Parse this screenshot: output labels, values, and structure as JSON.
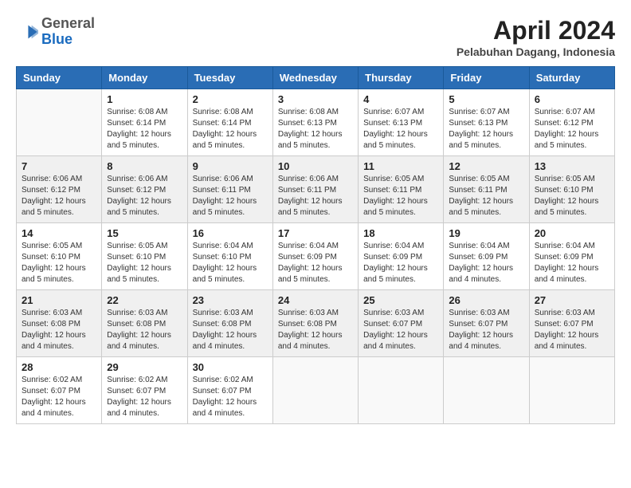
{
  "logo": {
    "general": "General",
    "blue": "Blue"
  },
  "header": {
    "month": "April 2024",
    "location": "Pelabuhan Dagang, Indonesia"
  },
  "weekdays": [
    "Sunday",
    "Monday",
    "Tuesday",
    "Wednesday",
    "Thursday",
    "Friday",
    "Saturday"
  ],
  "weeks": [
    [
      {
        "day": "",
        "info": ""
      },
      {
        "day": "1",
        "info": "Sunrise: 6:08 AM\nSunset: 6:14 PM\nDaylight: 12 hours and 5 minutes."
      },
      {
        "day": "2",
        "info": "Sunrise: 6:08 AM\nSunset: 6:14 PM\nDaylight: 12 hours and 5 minutes."
      },
      {
        "day": "3",
        "info": "Sunrise: 6:08 AM\nSunset: 6:13 PM\nDaylight: 12 hours and 5 minutes."
      },
      {
        "day": "4",
        "info": "Sunrise: 6:07 AM\nSunset: 6:13 PM\nDaylight: 12 hours and 5 minutes."
      },
      {
        "day": "5",
        "info": "Sunrise: 6:07 AM\nSunset: 6:13 PM\nDaylight: 12 hours and 5 minutes."
      },
      {
        "day": "6",
        "info": "Sunrise: 6:07 AM\nSunset: 6:12 PM\nDaylight: 12 hours and 5 minutes."
      }
    ],
    [
      {
        "day": "7",
        "info": "Sunrise: 6:06 AM\nSunset: 6:12 PM\nDaylight: 12 hours and 5 minutes."
      },
      {
        "day": "8",
        "info": "Sunrise: 6:06 AM\nSunset: 6:12 PM\nDaylight: 12 hours and 5 minutes."
      },
      {
        "day": "9",
        "info": "Sunrise: 6:06 AM\nSunset: 6:11 PM\nDaylight: 12 hours and 5 minutes."
      },
      {
        "day": "10",
        "info": "Sunrise: 6:06 AM\nSunset: 6:11 PM\nDaylight: 12 hours and 5 minutes."
      },
      {
        "day": "11",
        "info": "Sunrise: 6:05 AM\nSunset: 6:11 PM\nDaylight: 12 hours and 5 minutes."
      },
      {
        "day": "12",
        "info": "Sunrise: 6:05 AM\nSunset: 6:11 PM\nDaylight: 12 hours and 5 minutes."
      },
      {
        "day": "13",
        "info": "Sunrise: 6:05 AM\nSunset: 6:10 PM\nDaylight: 12 hours and 5 minutes."
      }
    ],
    [
      {
        "day": "14",
        "info": "Sunrise: 6:05 AM\nSunset: 6:10 PM\nDaylight: 12 hours and 5 minutes."
      },
      {
        "day": "15",
        "info": "Sunrise: 6:05 AM\nSunset: 6:10 PM\nDaylight: 12 hours and 5 minutes."
      },
      {
        "day": "16",
        "info": "Sunrise: 6:04 AM\nSunset: 6:10 PM\nDaylight: 12 hours and 5 minutes."
      },
      {
        "day": "17",
        "info": "Sunrise: 6:04 AM\nSunset: 6:09 PM\nDaylight: 12 hours and 5 minutes."
      },
      {
        "day": "18",
        "info": "Sunrise: 6:04 AM\nSunset: 6:09 PM\nDaylight: 12 hours and 5 minutes."
      },
      {
        "day": "19",
        "info": "Sunrise: 6:04 AM\nSunset: 6:09 PM\nDaylight: 12 hours and 4 minutes."
      },
      {
        "day": "20",
        "info": "Sunrise: 6:04 AM\nSunset: 6:09 PM\nDaylight: 12 hours and 4 minutes."
      }
    ],
    [
      {
        "day": "21",
        "info": "Sunrise: 6:03 AM\nSunset: 6:08 PM\nDaylight: 12 hours and 4 minutes."
      },
      {
        "day": "22",
        "info": "Sunrise: 6:03 AM\nSunset: 6:08 PM\nDaylight: 12 hours and 4 minutes."
      },
      {
        "day": "23",
        "info": "Sunrise: 6:03 AM\nSunset: 6:08 PM\nDaylight: 12 hours and 4 minutes."
      },
      {
        "day": "24",
        "info": "Sunrise: 6:03 AM\nSunset: 6:08 PM\nDaylight: 12 hours and 4 minutes."
      },
      {
        "day": "25",
        "info": "Sunrise: 6:03 AM\nSunset: 6:07 PM\nDaylight: 12 hours and 4 minutes."
      },
      {
        "day": "26",
        "info": "Sunrise: 6:03 AM\nSunset: 6:07 PM\nDaylight: 12 hours and 4 minutes."
      },
      {
        "day": "27",
        "info": "Sunrise: 6:03 AM\nSunset: 6:07 PM\nDaylight: 12 hours and 4 minutes."
      }
    ],
    [
      {
        "day": "28",
        "info": "Sunrise: 6:02 AM\nSunset: 6:07 PM\nDaylight: 12 hours and 4 minutes."
      },
      {
        "day": "29",
        "info": "Sunrise: 6:02 AM\nSunset: 6:07 PM\nDaylight: 12 hours and 4 minutes."
      },
      {
        "day": "30",
        "info": "Sunrise: 6:02 AM\nSunset: 6:07 PM\nDaylight: 12 hours and 4 minutes."
      },
      {
        "day": "",
        "info": ""
      },
      {
        "day": "",
        "info": ""
      },
      {
        "day": "",
        "info": ""
      },
      {
        "day": "",
        "info": ""
      }
    ]
  ]
}
